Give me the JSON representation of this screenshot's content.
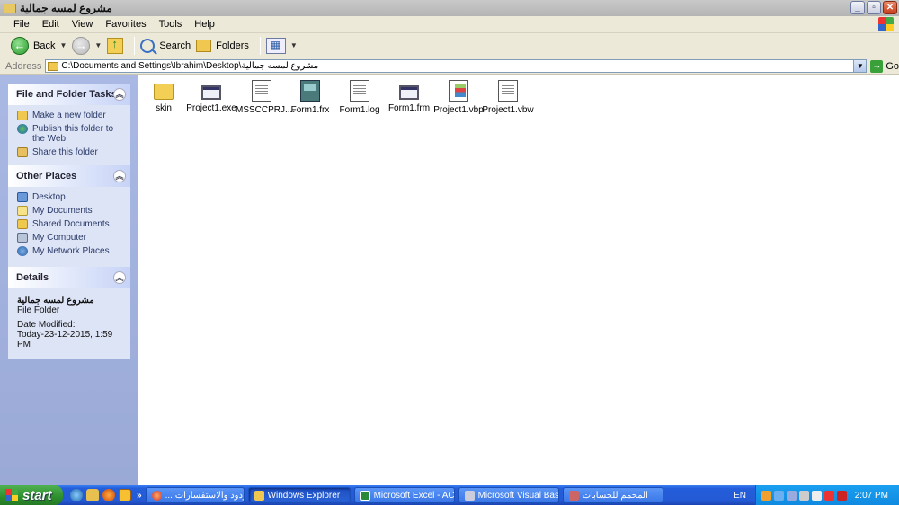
{
  "window": {
    "title": "مشروع لمسه جمالية"
  },
  "menu": [
    "File",
    "Edit",
    "View",
    "Favorites",
    "Tools",
    "Help"
  ],
  "toolbar": {
    "back_label": "Back",
    "search_label": "Search",
    "folders_label": "Folders"
  },
  "address": {
    "label": "Address",
    "path": "C:\\Documents and Settings\\Ibrahim\\Desktop\\مشروع لمسه جمالية",
    "go_label": "Go"
  },
  "left_pane": {
    "file_tasks": {
      "title": "File and Folder Tasks",
      "items": [
        {
          "label": "Make a new folder",
          "icon": "new-folder-icon"
        },
        {
          "label": "Publish this folder to the Web",
          "icon": "globe-icon"
        },
        {
          "label": "Share this folder",
          "icon": "share-icon"
        }
      ]
    },
    "other_places": {
      "title": "Other Places",
      "items": [
        {
          "label": "Desktop",
          "icon": "desktop-icon"
        },
        {
          "label": "My Documents",
          "icon": "documents-icon"
        },
        {
          "label": "Shared Documents",
          "icon": "shared-folder-icon"
        },
        {
          "label": "My Computer",
          "icon": "computer-icon"
        },
        {
          "label": "My Network Places",
          "icon": "network-icon"
        }
      ]
    },
    "details": {
      "title": "Details",
      "name": "مشروع لمسه جمالية",
      "type": "File Folder",
      "modified_label": "Date Modified:",
      "modified_value": "Today-23-12-2015, 1:59 PM"
    }
  },
  "files": [
    {
      "name": "skin",
      "icon": "folder-icon"
    },
    {
      "name": "Project1.exe",
      "icon": "exe-icon"
    },
    {
      "name": "MSSCCPRJ....",
      "icon": "document-icon"
    },
    {
      "name": "Form1.frx",
      "icon": "frx-icon"
    },
    {
      "name": "Form1.log",
      "icon": "text-file-icon"
    },
    {
      "name": "Form1.frm",
      "icon": "exe-icon"
    },
    {
      "name": "Project1.vbp",
      "icon": "vb-project-icon"
    },
    {
      "name": "Project1.vbw",
      "icon": "document-icon"
    }
  ],
  "taskbar": {
    "start_label": "start",
    "more_label": "»",
    "buttons": [
      {
        "label": "... الردود والاستفسارات",
        "icon": "browser-icon"
      },
      {
        "label": "Windows Explorer",
        "icon": "folder-icon",
        "active": true
      },
      {
        "label": "Microsoft Excel - ACC...",
        "icon": "excel-icon"
      },
      {
        "label": "Microsoft Visual Basic ...",
        "icon": "vb-icon"
      },
      {
        "label": "المحمم للحسابات",
        "icon": "app-icon"
      }
    ],
    "language": "EN",
    "clock": "2:07 PM"
  }
}
